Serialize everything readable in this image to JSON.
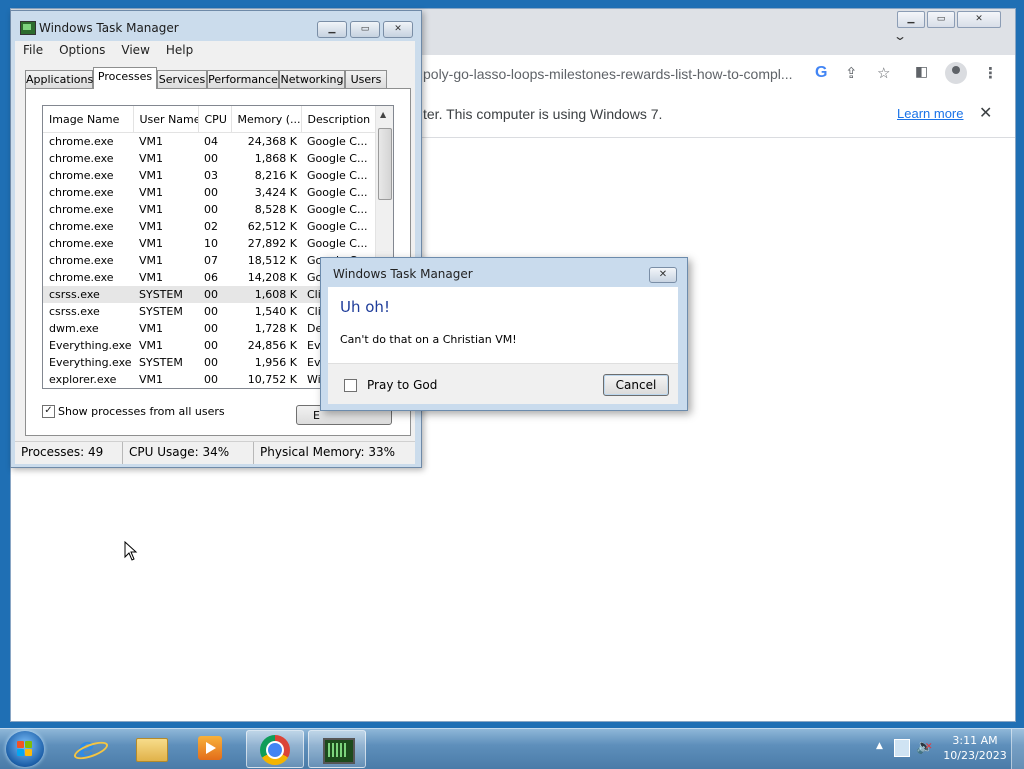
{
  "chrome": {
    "url_text": "poly-go-lasso-loops-milestones-rewards-list-how-to-compl...",
    "toolbar_icons": [
      "google-icon",
      "share-icon",
      "star-icon",
      "sidepanel-icon",
      "profile-icon",
      "menu-icon"
    ],
    "infobar_text": "ter. This computer is using Windows 7.",
    "learn_more": "Learn more"
  },
  "taskmanager": {
    "title": "Windows Task Manager",
    "menu": [
      "File",
      "Options",
      "View",
      "Help"
    ],
    "tabs": [
      "Applications",
      "Processes",
      "Services",
      "Performance",
      "Networking",
      "Users"
    ],
    "active_tab": "Processes",
    "columns": [
      "Image Name",
      "User Name",
      "CPU",
      "Memory (...",
      "Description"
    ],
    "rows": [
      [
        "chrome.exe",
        "VM1",
        "04",
        "24,368 K",
        "Google C..."
      ],
      [
        "chrome.exe",
        "VM1",
        "00",
        "1,868 K",
        "Google C..."
      ],
      [
        "chrome.exe",
        "VM1",
        "03",
        "8,216 K",
        "Google C..."
      ],
      [
        "chrome.exe",
        "VM1",
        "00",
        "3,424 K",
        "Google C..."
      ],
      [
        "chrome.exe",
        "VM1",
        "00",
        "8,528 K",
        "Google C..."
      ],
      [
        "chrome.exe",
        "VM1",
        "02",
        "62,512 K",
        "Google C..."
      ],
      [
        "chrome.exe",
        "VM1",
        "10",
        "27,892 K",
        "Google C..."
      ],
      [
        "chrome.exe",
        "VM1",
        "07",
        "18,512 K",
        "Google C..."
      ],
      [
        "chrome.exe",
        "VM1",
        "06",
        "14,208 K",
        "Goo"
      ],
      [
        "csrss.exe",
        "SYSTEM",
        "00",
        "1,608 K",
        "Clie"
      ],
      [
        "csrss.exe",
        "SYSTEM",
        "00",
        "1,540 K",
        "Clie"
      ],
      [
        "dwm.exe",
        "VM1",
        "00",
        "1,728 K",
        "Des"
      ],
      [
        "Everything.exe",
        "VM1",
        "00",
        "24,856 K",
        "Eve"
      ],
      [
        "Everything.exe",
        "SYSTEM",
        "00",
        "1,956 K",
        "Eve"
      ],
      [
        "explorer.exe",
        "VM1",
        "00",
        "10,752 K",
        "Win"
      ]
    ],
    "selected_row": 9,
    "show_all_label": "Show processes from all users",
    "show_all_checked": "✓",
    "end_process_label": "E",
    "status": {
      "processes": "Processes: 49",
      "cpu": "CPU Usage: 34%",
      "memory": "Physical Memory: 33%"
    }
  },
  "dialog": {
    "title": "Windows Task Manager",
    "heading": "Uh oh!",
    "message": "Can't do that on a Christian VM!",
    "checkbox_label": "Pray to God",
    "cancel_label": "Cancel"
  },
  "taskbar": {
    "apps": [
      "internet-explorer",
      "windows-explorer",
      "media-player",
      "google-chrome",
      "task-manager"
    ],
    "active_apps": [
      "google-chrome",
      "task-manager"
    ],
    "time": "3:11 AM",
    "date": "10/23/2023"
  }
}
